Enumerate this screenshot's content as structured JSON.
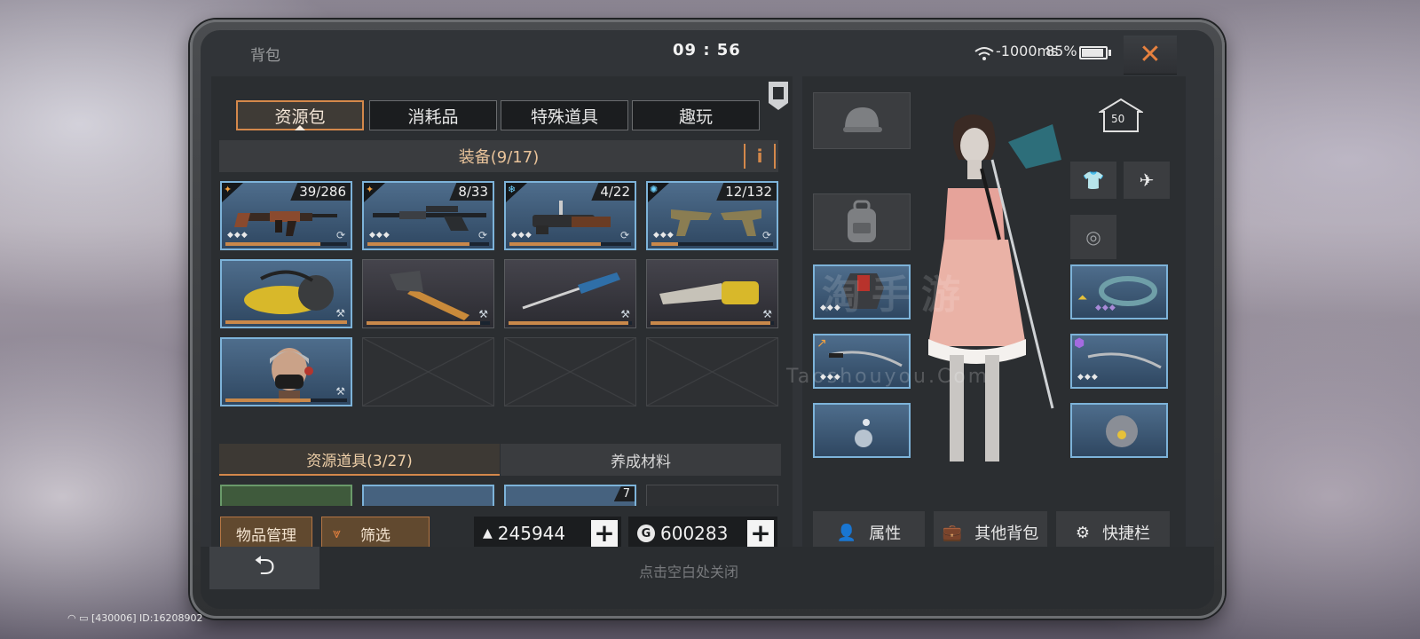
{
  "status_bar": {
    "title": "背包",
    "time": "09 : 56",
    "network": "-1000ms",
    "battery": "85%",
    "battery_level": 0.85
  },
  "tabs": [
    {
      "label": "资源包",
      "active": true
    },
    {
      "label": "消耗品",
      "active": false
    },
    {
      "label": "特殊道具",
      "active": false
    },
    {
      "label": "趣玩",
      "active": false
    }
  ],
  "equipment_header": "装备(9/17)",
  "info_label": "i",
  "equipment_slots": [
    {
      "item": "assault-rifle",
      "count": "39/286",
      "quality": "orange"
    },
    {
      "item": "sniper-rifle",
      "count": "8/33",
      "quality": "orange"
    },
    {
      "item": "grenade-launcher",
      "count": "4/22",
      "quality": "blue"
    },
    {
      "item": "dual-pistols",
      "count": "12/132",
      "quality": "blue"
    },
    {
      "item": "yellow-chainsaw-tool"
    },
    {
      "item": "hammer"
    },
    {
      "item": "screwdriver"
    },
    {
      "item": "chainsaw"
    },
    {
      "item": "mask-helmet"
    }
  ],
  "sub_tabs": [
    {
      "label": "资源道具(3/27)",
      "active": true
    },
    {
      "label": "养成材料",
      "active": false
    }
  ],
  "resource_preview": [
    {
      "count": ""
    },
    {
      "count": ""
    },
    {
      "count": "7"
    },
    {
      "count": ""
    }
  ],
  "bottom_left": {
    "manage": "物品管理",
    "filter": "筛选"
  },
  "currency": [
    {
      "icon": "gold-bar-icon",
      "value": "245944"
    },
    {
      "icon": "coin-icon",
      "value": "600283"
    }
  ],
  "character": {
    "level": "50"
  },
  "right_actions": [
    {
      "label": "属性",
      "icon": "person-icon"
    },
    {
      "label": "其他背包",
      "icon": "bag-icon"
    },
    {
      "label": "快捷栏",
      "icon": "grid-gear-icon"
    }
  ],
  "footer_hint": "点击空白处关闭",
  "watermark": {
    "cn": "淘手游",
    "en": "Taoshouyou.Com"
  },
  "bottom_status": "[430006] ID:16208902",
  "colors": {
    "accent": "#d4884b",
    "slot_blue": "#7db3d9",
    "close": "#e6813f"
  }
}
